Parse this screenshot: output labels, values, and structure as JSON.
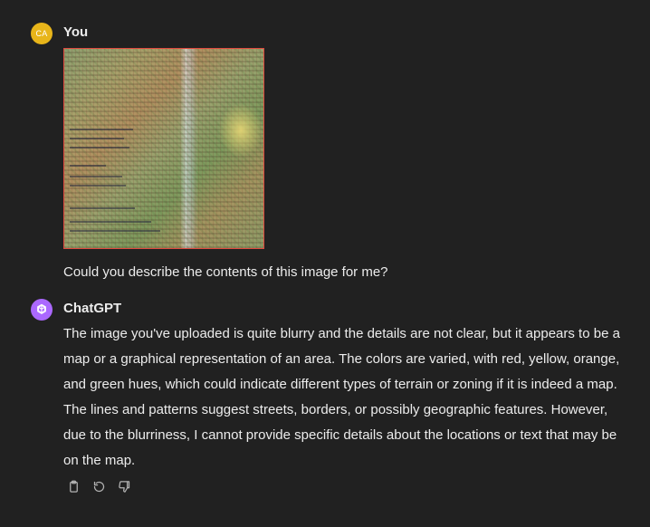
{
  "user_message": {
    "avatar_initials": "CA",
    "author": "You",
    "image_alt": "uploaded map image",
    "text": "Could you describe the contents of this image for me?"
  },
  "assistant_message": {
    "author": "ChatGPT",
    "text": "The image you've uploaded is quite blurry and the details are not clear, but it appears to be a map or a graphical representation of an area. The colors are varied, with red, yellow, orange, and green hues, which could indicate different types of terrain or zoning if it is indeed a map. The lines and patterns suggest streets, borders, or possibly geographic features. However, due to the blurriness, I cannot provide specific details about the locations or text that may be on the map.",
    "actions": [
      {
        "name": "copy",
        "icon": "clipboard-icon"
      },
      {
        "name": "regenerate",
        "icon": "refresh-icon"
      },
      {
        "name": "dislike",
        "icon": "thumbs-down-icon"
      }
    ]
  },
  "colors": {
    "background": "#212121",
    "text": "#ececec",
    "user_avatar": "#e8b51a",
    "assistant_avatar": "#ab68ff",
    "icon": "#b4b4b4"
  }
}
